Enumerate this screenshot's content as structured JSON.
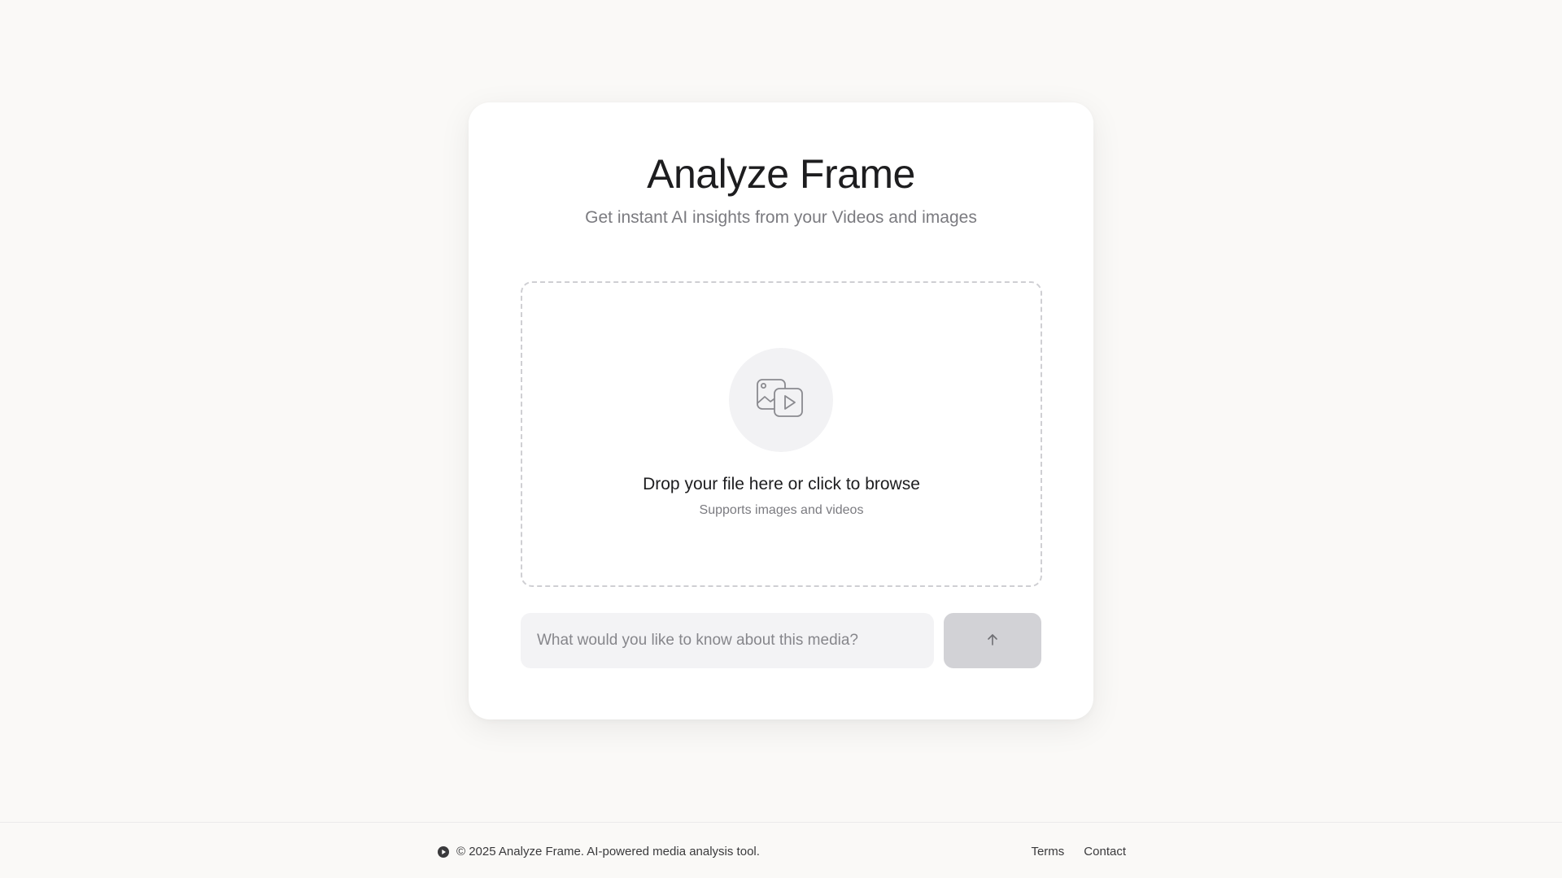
{
  "hero": {
    "title": "Analyze Frame",
    "subtitle": "Get instant AI insights from your Videos and images"
  },
  "dropzone": {
    "icon": "image-video-icon",
    "primary_text": "Drop your file here or click to browse",
    "secondary_text": "Supports images and videos"
  },
  "query": {
    "placeholder": "What would you like to know about this media?",
    "value": "",
    "send_icon": "arrow-up-icon"
  },
  "footer": {
    "logo_icon": "play-circle-icon",
    "copyright": "© 2025 Analyze Frame. AI-powered media analysis tool.",
    "links": [
      {
        "label": "Terms"
      },
      {
        "label": "Contact"
      }
    ]
  },
  "colors": {
    "background": "#faf9f7",
    "card": "#ffffff",
    "text_primary": "#1d1d1f",
    "text_secondary": "#7b7b80",
    "input_bg": "#f3f3f5",
    "send_button_disabled": "#d2d2d6"
  }
}
